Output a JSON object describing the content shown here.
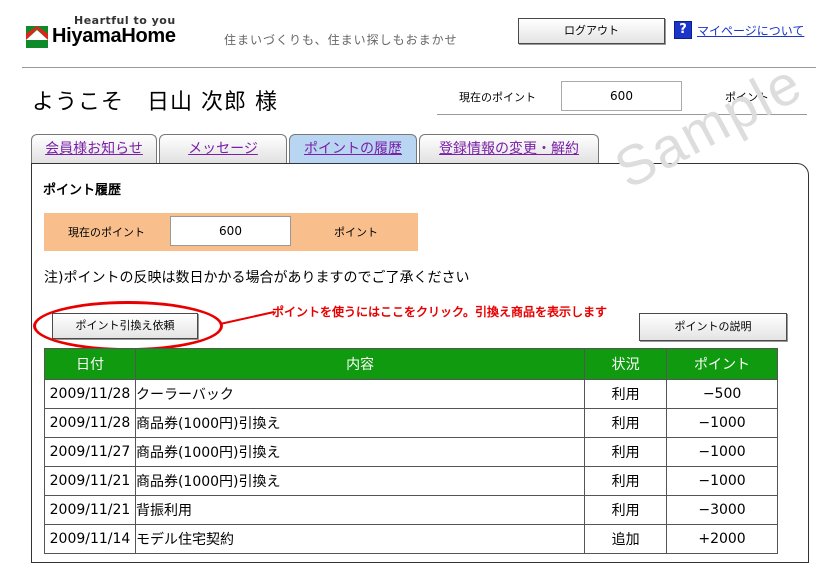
{
  "header": {
    "tagline": "Heartful to you",
    "brand": "HiyamaHome",
    "slogan": "住まいづくりも、住まい探しもおまかせ",
    "logout_label": "ログアウト",
    "help_glyph": "?",
    "mypage_link": "マイページについて"
  },
  "welcome": {
    "greeting": "ようこそ　日山 次郎 様",
    "points_label": "現在のポイント",
    "points_value": "600",
    "points_unit": "ポイント"
  },
  "tabs": [
    {
      "label": "会員様お知らせ",
      "active": false
    },
    {
      "label": "メッセージ",
      "active": false
    },
    {
      "label": "ポイントの履歴",
      "active": true
    },
    {
      "label": "登録情報の変更・解約",
      "active": false
    }
  ],
  "panel": {
    "title": "ポイント履歴",
    "points_label": "現在のポイント",
    "points_value": "600",
    "points_unit": "ポイント",
    "note": "注)ポイントの反映は数日かかる場合がありますのでご了承ください",
    "redeem_button": "ポイント引換え依頼",
    "redeem_hint": "ポイントを使うにはここをクリック。引換え商品を表示します",
    "explain_button": "ポイントの説明",
    "watermark": "Sample"
  },
  "history": {
    "columns": [
      "日付",
      "内容",
      "状況",
      "ポイント"
    ],
    "rows": [
      [
        "2009/11/28",
        "クーラーバック",
        "利用",
        "−500"
      ],
      [
        "2009/11/28",
        "商品券(1000円)引換え",
        "利用",
        "−1000"
      ],
      [
        "2009/11/27",
        "商品券(1000円)引換え",
        "利用",
        "−1000"
      ],
      [
        "2009/11/21",
        "商品券(1000円)引換え",
        "利用",
        "−1000"
      ],
      [
        "2009/11/21",
        "背振利用",
        "利用",
        "−3000"
      ],
      [
        "2009/11/14",
        "モデル住宅契約",
        "追加",
        "+2000"
      ]
    ]
  },
  "colors": {
    "table_header": "#0f9a0f",
    "points_bar": "#f8bf8c",
    "active_tab": "#b8d6f2",
    "highlight": "#e80000",
    "link": "#1a35c8"
  },
  "icons": {
    "logo": "hiyama-house-logo-icon",
    "help": "help-question-icon"
  }
}
